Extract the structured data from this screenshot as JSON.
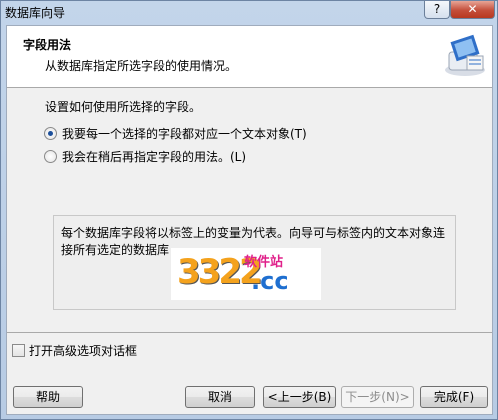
{
  "window": {
    "title": "数据库向导",
    "help_glyph": "?",
    "close_glyph": "✕"
  },
  "header": {
    "title": "字段用法",
    "subtitle": "从数据库指定所选字段的使用情况。"
  },
  "content": {
    "label": "设置如何使用所选择的字段。",
    "options": [
      {
        "label": "我要每一个选择的字段都对应一个文本对象(T)",
        "checked": true
      },
      {
        "label": "我会在稍后再指定字段的用法。(L)",
        "checked": false
      }
    ],
    "info": "每个数据库字段将以标签上的变量为代表。向导可与标签内的文本对象连接所有选定的数据库"
  },
  "watermark": {
    "number": "3322",
    "top_text": "软件站",
    "suffix": ".cc"
  },
  "advanced_option": {
    "label": "打开高级选项对话框",
    "checked": false
  },
  "buttons": {
    "help": "帮助",
    "cancel": "取消",
    "back": "<上一步(B)",
    "next": "下一步(N)>",
    "finish": "完成(F)"
  }
}
